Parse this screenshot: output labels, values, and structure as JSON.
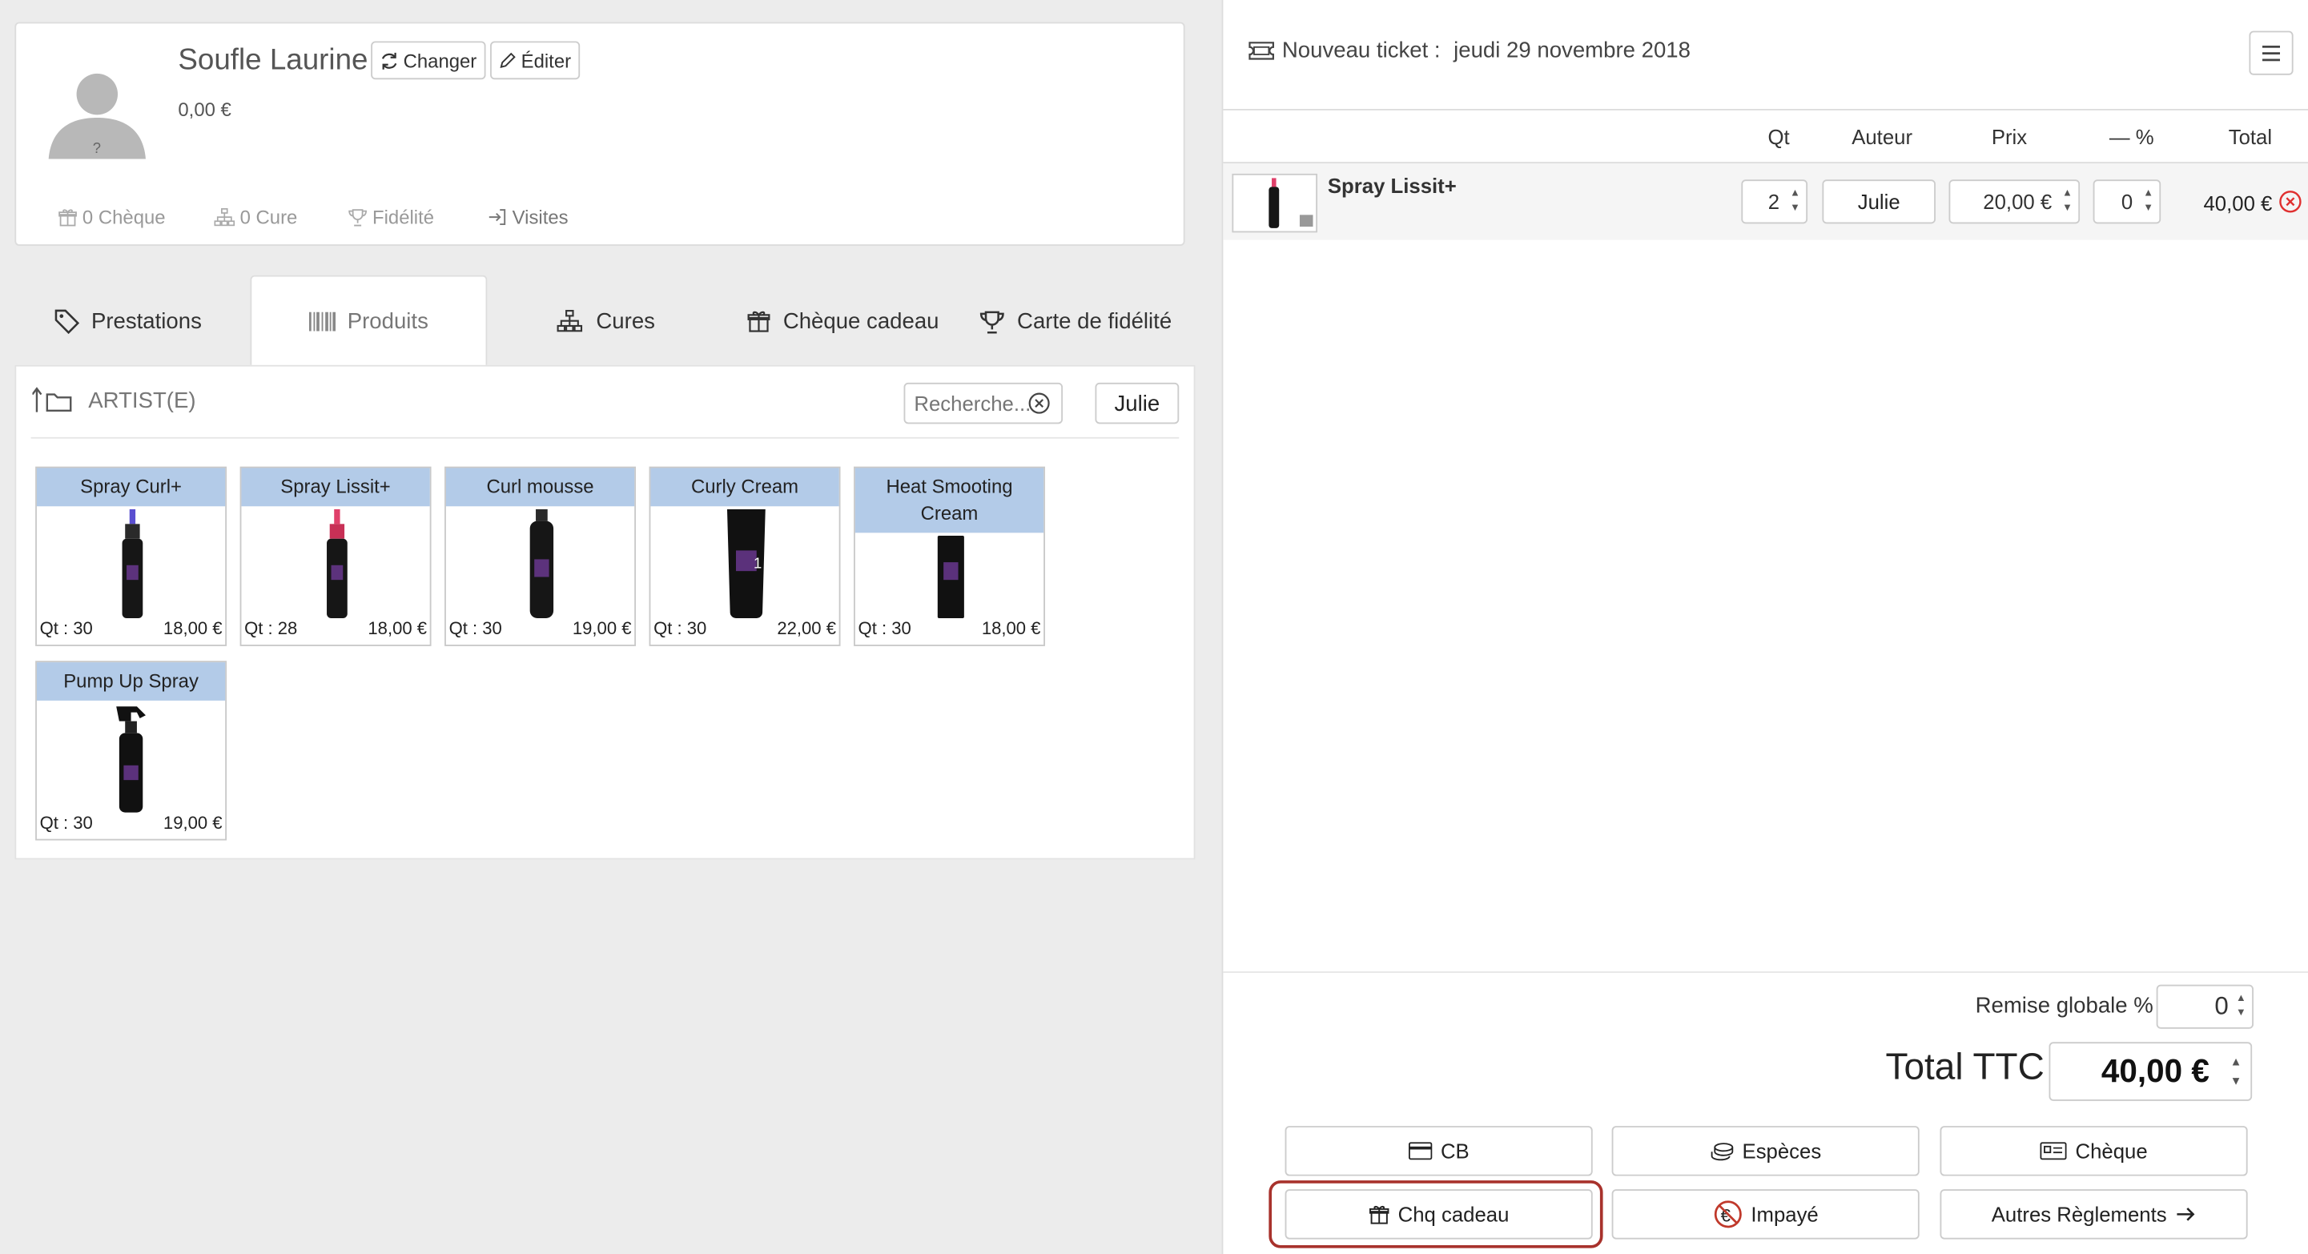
{
  "client": {
    "name": "Soufle Laurine",
    "change_label": "Changer",
    "edit_label": "Éditer",
    "balance": "0,00 €",
    "stats": {
      "cheque": "0 Chèque",
      "cure": "0 Cure",
      "fidelite": "Fidélité",
      "visites": "Visites"
    }
  },
  "tabs": [
    {
      "label": "Prestations",
      "icon": "tag-icon"
    },
    {
      "label": "Produits",
      "icon": "barcode-icon",
      "active": true
    },
    {
      "label": "Cures",
      "icon": "sitemap-icon"
    },
    {
      "label": "Chèque cadeau",
      "icon": "gift-icon"
    },
    {
      "label": "Carte de fidélité",
      "icon": "trophy-icon"
    }
  ],
  "catalog": {
    "folder": "ARTIST(E)",
    "search_placeholder": "Recherche...",
    "author_filter": "Julie",
    "products": [
      {
        "name": "Spray Curl+",
        "qt": "Qt : 30",
        "price": "18,00 €",
        "accent": "#5a4fd0"
      },
      {
        "name": "Spray Lissit+",
        "qt": "Qt : 28",
        "price": "18,00 €",
        "accent": "#e0406a"
      },
      {
        "name": "Curl mousse",
        "qt": "Qt : 30",
        "price": "19,00 €",
        "accent": "#8b3fa0"
      },
      {
        "name": "Curly Cream",
        "qt": "Qt : 30",
        "price": "22,00 €",
        "accent": "#8b3fa0"
      },
      {
        "name": "Heat Smooting Cream",
        "qt": "Qt : 30",
        "price": "18,00 €",
        "accent": "#8b3fa0"
      },
      {
        "name": "Pump Up Spray",
        "qt": "Qt : 30",
        "price": "19,00 €",
        "accent": "#8b3fa0"
      }
    ]
  },
  "ticket": {
    "title": "Nouveau ticket :",
    "date": "jeudi 29 novembre 2018",
    "columns": {
      "qt": "Qt",
      "auteur": "Auteur",
      "prix": "Prix",
      "remise": "— %",
      "total": "Total"
    },
    "line": {
      "product": "Spray Lissit+",
      "qt": "2",
      "author": "Julie",
      "price": "20,00 €",
      "discount": "0",
      "total": "40,00 €"
    },
    "remise_label": "Remise globale %",
    "remise_value": "0",
    "total_label": "Total TTC",
    "total_value": "40,00 €"
  },
  "payments": {
    "cb": "CB",
    "especes": "Espèces",
    "cheque": "Chèque",
    "chq_cadeau": "Chq cadeau",
    "impaye": "Impayé",
    "autres": "Autres Règlements"
  },
  "colors": {
    "tile_header": "#b3cbe8",
    "highlight": "#a8322c",
    "delete": "#e03030"
  }
}
